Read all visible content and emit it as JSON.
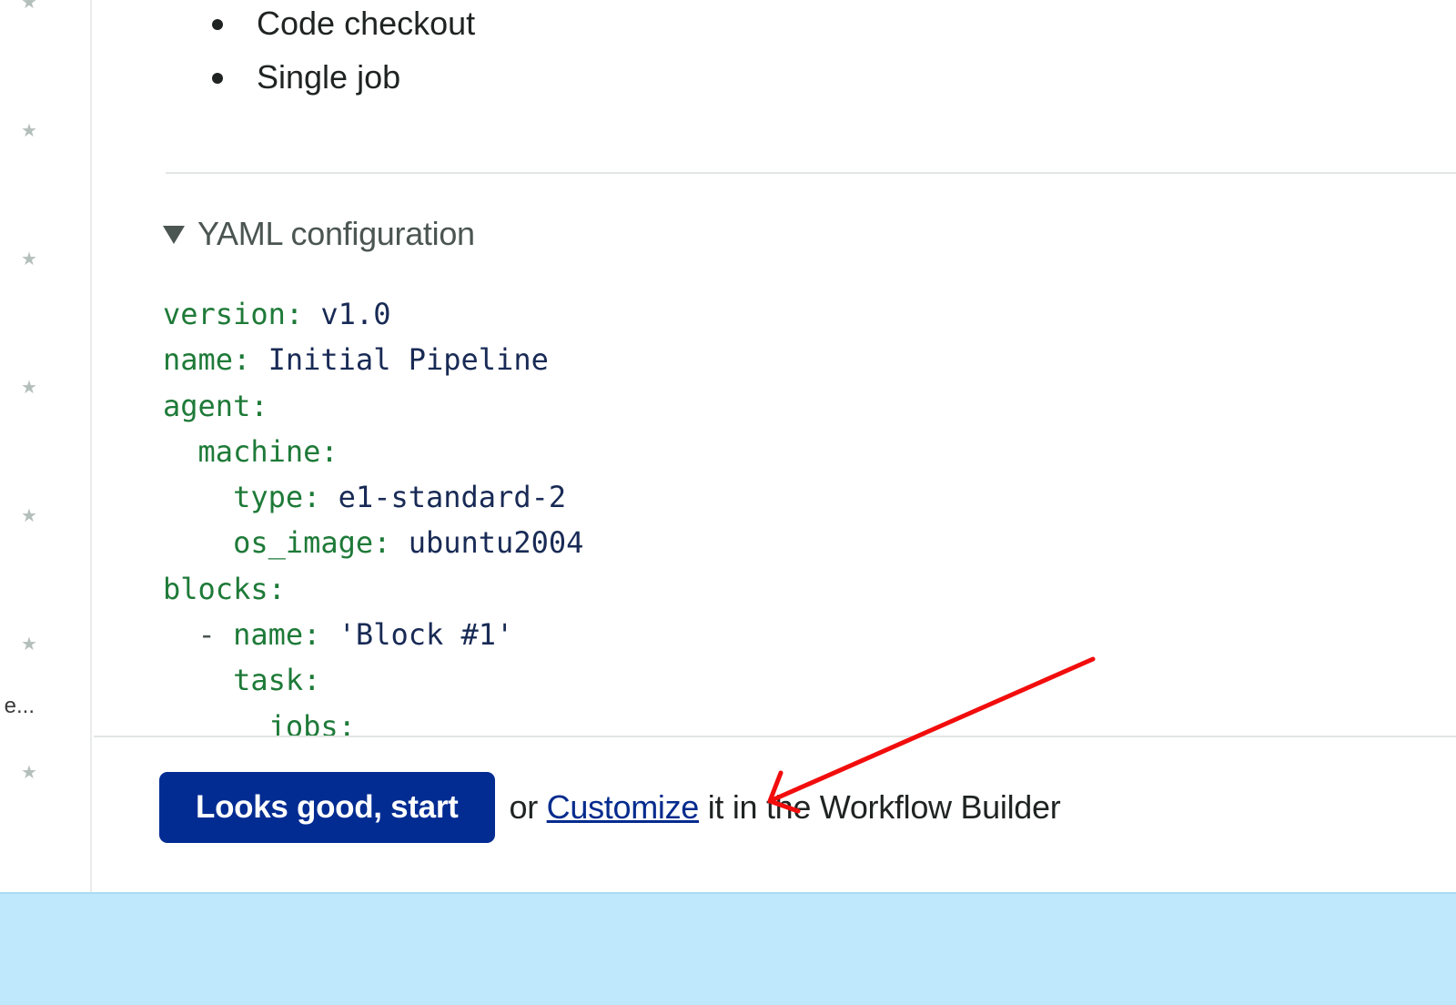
{
  "sidebar": {
    "star_icon": "★",
    "truncated_label": "e...",
    "star_count": 7
  },
  "summary": {
    "items": [
      "Code checkout",
      "Single job"
    ]
  },
  "yaml_section": {
    "toggle_label": "YAML configuration",
    "expanded": true,
    "lines": [
      {
        "indent": "",
        "key": "version:",
        "value": " v1.0"
      },
      {
        "indent": "",
        "key": "name:",
        "value": " Initial Pipeline"
      },
      {
        "indent": "",
        "key": "agent:",
        "value": ""
      },
      {
        "indent": "  ",
        "key": "machine:",
        "value": ""
      },
      {
        "indent": "    ",
        "key": "type:",
        "value": " e1-standard-2"
      },
      {
        "indent": "    ",
        "key": "os_image:",
        "value": " ubuntu2004"
      },
      {
        "indent": "",
        "key": "blocks:",
        "value": ""
      },
      {
        "indent": "  - ",
        "key": "name:",
        "value": " 'Block #1'"
      },
      {
        "indent": "    ",
        "key": "task:",
        "value": ""
      },
      {
        "indent": "      ",
        "key": "jobs:",
        "value": ""
      }
    ]
  },
  "footer": {
    "primary_label": "Looks good, start",
    "text_before": "or ",
    "link_label": "Customize",
    "text_after": " it in the Workflow Builder"
  },
  "annotation": {
    "arrow_color": "#f20d0d"
  },
  "colors": {
    "primary": "#022c92",
    "yaml_key": "#1e7a38",
    "yaml_value": "#182a55",
    "backdrop": "#bfe8fc"
  }
}
